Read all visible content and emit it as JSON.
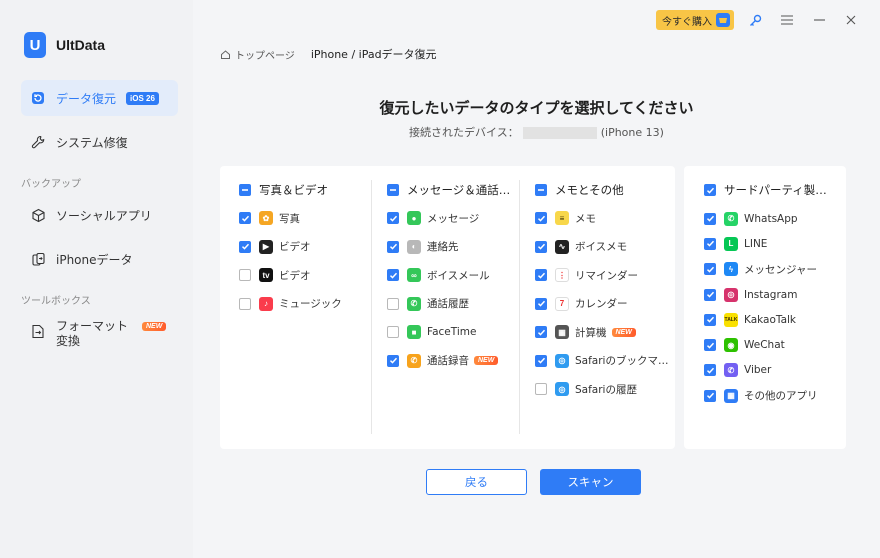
{
  "app": {
    "name": "UltData",
    "logo_letter": "U"
  },
  "sidebar": {
    "items": [
      {
        "label": "データ復元",
        "badge": "iOS 26",
        "active": true,
        "icon": "restore-icon"
      },
      {
        "label": "システム修復",
        "icon": "wrench-icon"
      },
      {
        "label": "ソーシャルアプリ",
        "icon": "cube-icon"
      },
      {
        "label": "iPhoneデータ",
        "icon": "phone-transfer-icon"
      },
      {
        "label": "フォーマット変換",
        "badge": "NEW",
        "icon": "convert-icon"
      }
    ],
    "sections": {
      "backup": "バックアップ",
      "toolbox": "ツールボックス"
    }
  },
  "topbar": {
    "buy_label": "今すぐ購入",
    "icons": [
      "cart-icon",
      "key-icon",
      "menu-icon",
      "minimize-icon",
      "close-icon"
    ]
  },
  "breadcrumb": {
    "home": "トップページ",
    "current": "iPhone / iPadデータ復元"
  },
  "heading": {
    "title": "復元したいデータのタイプを選択してください",
    "device_label": "接続されたデバイス：",
    "device_model": "(iPhone 13)"
  },
  "categories": [
    {
      "title": "写真＆ビデオ",
      "state": "partial",
      "items": [
        {
          "label": "写真",
          "checked": true,
          "icon": "photos-icon",
          "color": "#f5a623"
        },
        {
          "label": "ビデオ",
          "checked": true,
          "icon": "clapper-icon",
          "color": "#222222"
        },
        {
          "label": "ビデオ",
          "checked": false,
          "icon": "appletv-icon",
          "color": "#111111"
        },
        {
          "label": "ミュージック",
          "checked": false,
          "icon": "music-icon",
          "color": "#fa3c4c"
        }
      ]
    },
    {
      "title": "メッセージ＆通話…",
      "state": "partial",
      "items": [
        {
          "label": "メッセージ",
          "checked": true,
          "icon": "message-icon",
          "color": "#34c759"
        },
        {
          "label": "連絡先",
          "checked": true,
          "icon": "contacts-icon",
          "color": "#b8b8b8"
        },
        {
          "label": "ボイスメール",
          "checked": true,
          "icon": "voicemail-icon",
          "color": "#34c759"
        },
        {
          "label": "通話履歴",
          "checked": false,
          "icon": "phone-icon",
          "color": "#34c759"
        },
        {
          "label": "FaceTime",
          "checked": false,
          "icon": "facetime-icon",
          "color": "#34c759"
        },
        {
          "label": "通話録音",
          "checked": true,
          "icon": "call-record-icon",
          "color": "#f7a31c",
          "badge": "NEW"
        }
      ]
    },
    {
      "title": "メモとその他",
      "state": "partial",
      "items": [
        {
          "label": "メモ",
          "checked": true,
          "icon": "notes-icon",
          "color": "#f8d74a"
        },
        {
          "label": "ボイスメモ",
          "checked": true,
          "icon": "voice-memo-icon",
          "color": "#222222"
        },
        {
          "label": "リマインダー",
          "checked": true,
          "icon": "reminders-icon",
          "color": "#ffffff"
        },
        {
          "label": "カレンダー",
          "checked": true,
          "icon": "calendar-icon",
          "color": "#ffffff"
        },
        {
          "label": "計算機",
          "checked": true,
          "icon": "calculator-icon",
          "color": "#555555",
          "badge": "NEW"
        },
        {
          "label": "Safariのブックマ…",
          "checked": true,
          "icon": "safari-icon",
          "color": "#2f9bf0"
        },
        {
          "label": "Safariの履歴",
          "checked": false,
          "icon": "safari-icon",
          "color": "#2f9bf0"
        }
      ]
    },
    {
      "title": "サードパーティ製…",
      "state": "checked",
      "items": [
        {
          "label": "WhatsApp",
          "checked": true,
          "icon": "whatsapp-icon",
          "color": "#25d366"
        },
        {
          "label": "LINE",
          "checked": true,
          "icon": "line-icon",
          "color": "#06c755"
        },
        {
          "label": "メッセンジャー",
          "checked": true,
          "icon": "messenger-icon",
          "color": "#1e88f5"
        },
        {
          "label": "Instagram",
          "checked": true,
          "icon": "instagram-icon",
          "color": "#d6336c"
        },
        {
          "label": "KakaoTalk",
          "checked": true,
          "icon": "kakaotalk-icon",
          "color": "#f9e000"
        },
        {
          "label": "WeChat",
          "checked": true,
          "icon": "wechat-icon",
          "color": "#2dc100"
        },
        {
          "label": "Viber",
          "checked": true,
          "icon": "viber-icon",
          "color": "#7360f2"
        },
        {
          "label": "その他のアプリ",
          "checked": true,
          "icon": "other-apps-icon",
          "color": "#2f7cf6"
        }
      ]
    }
  ],
  "buttons": {
    "back": "戻る",
    "scan": "スキャン"
  },
  "colors": {
    "accent": "#2f7cf6",
    "buy": "#f8c546",
    "new_badge": "#ff6a33"
  }
}
